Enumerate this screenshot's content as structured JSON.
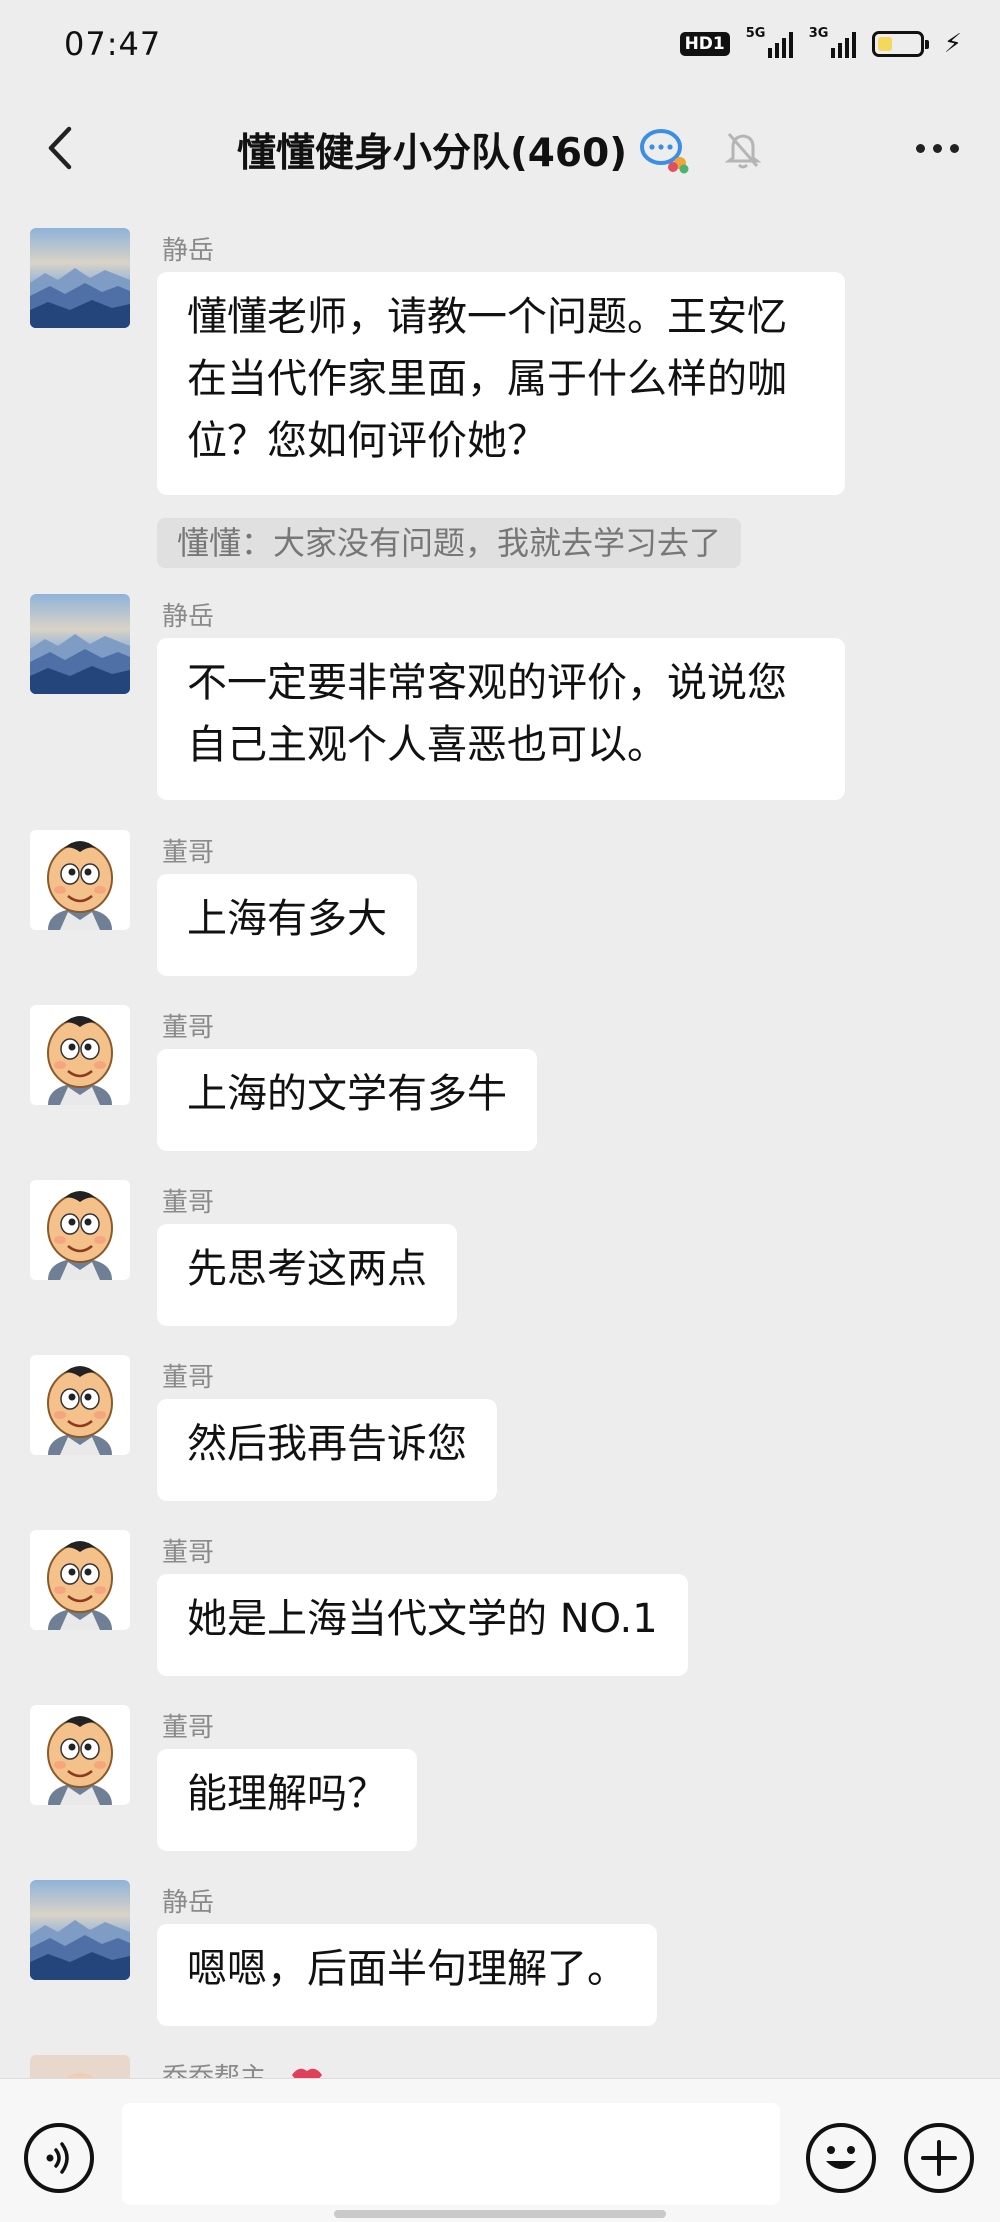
{
  "status_bar": {
    "time": "07:47",
    "hd_label": "HD1",
    "network_1": "5G",
    "network_2": "3G",
    "battery_level": 0.35,
    "charging_icon": "bolt-icon"
  },
  "nav": {
    "title": "懂懂健身小分队(460)",
    "back_icon": "chevron-left-icon",
    "chat_icon": "group-chat-icon",
    "mute_icon": "bell-off-icon",
    "more_icon": "more-dots-icon"
  },
  "messages": [
    {
      "sender": "静岳",
      "avatar": "mountain-avatar",
      "lines": [
        "懂懂老师，请教一个问题。王安忆",
        "在当代作家里面，属于什么样的咖",
        "位？您如何评价她？"
      ],
      "quote": "懂懂：大家没有问题，我就去学习去了"
    },
    {
      "sender": "静岳",
      "avatar": "mountain-avatar",
      "lines": [
        "不一定要非常客观的评价，说说您",
        "自己主观个人喜恶也可以。"
      ]
    },
    {
      "sender": "董哥",
      "avatar": "cartoon-baby-avatar",
      "lines": [
        "上海有多大"
      ]
    },
    {
      "sender": "董哥",
      "avatar": "cartoon-baby-avatar",
      "lines": [
        "上海的文学有多牛"
      ]
    },
    {
      "sender": "董哥",
      "avatar": "cartoon-baby-avatar",
      "lines": [
        "先思考这两点"
      ]
    },
    {
      "sender": "董哥",
      "avatar": "cartoon-baby-avatar",
      "lines": [
        "然后我再告诉您"
      ]
    },
    {
      "sender": "董哥",
      "avatar": "cartoon-baby-avatar",
      "lines": [
        "她是上海当代文学的 NO.1"
      ]
    },
    {
      "sender": "董哥",
      "avatar": "cartoon-baby-avatar",
      "lines": [
        "能理解吗？"
      ]
    },
    {
      "sender": "静岳",
      "avatar": "mountain-avatar",
      "lines": [
        "嗯嗯，后面半句理解了。"
      ]
    },
    {
      "sender": "乔乔帮主",
      "avatar": "person-avatar",
      "sender_badge": "lips-icon",
      "lines": []
    }
  ],
  "input_bar": {
    "voice_icon": "voice-icon",
    "emoji_icon": "smiley-icon",
    "plus_icon": "plus-icon",
    "input_value": ""
  },
  "colors": {
    "background": "#ededed",
    "bubble": "#ffffff",
    "sender_text": "#8a8a8a",
    "quote_bg": "#e0e0e0"
  }
}
